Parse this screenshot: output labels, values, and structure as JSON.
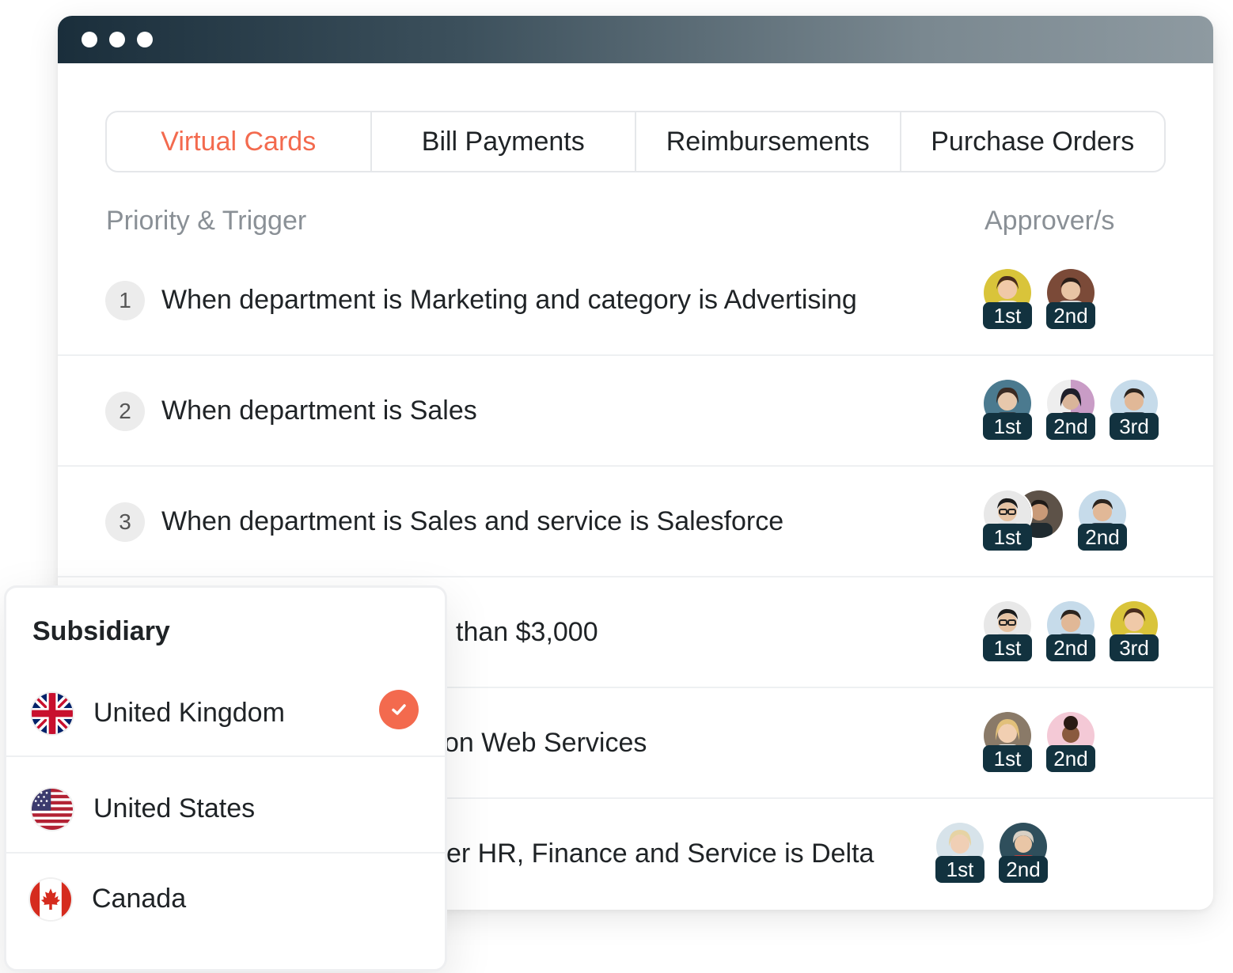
{
  "tabs": [
    "Virtual Cards",
    "Bill Payments",
    "Reimbursements",
    "Purchase Orders"
  ],
  "active_tab": "Virtual Cards",
  "columns": {
    "trigger": "Priority & Trigger",
    "approvers": "Approver/s"
  },
  "rules": [
    {
      "priority": "1",
      "trigger": "When department is Marketing and category is Advertising",
      "approvers": [
        "1st",
        "2nd"
      ]
    },
    {
      "priority": "2",
      "trigger": "When department is Sales",
      "approvers": [
        "1st",
        "2nd",
        "3rd"
      ]
    },
    {
      "priority": "3",
      "trigger": "When department is Sales and service is Salesforce",
      "approvers": [
        "1st",
        "2nd"
      ]
    },
    {
      "trigger": "than $3,000",
      "approvers": [
        "1st",
        "2nd",
        "3rd"
      ]
    },
    {
      "trigger": "on Web Services",
      "approvers": [
        "1st",
        "2nd"
      ]
    },
    {
      "trigger": "er HR, Finance and Service is Delta",
      "approvers": [
        "1st",
        "2nd"
      ]
    }
  ],
  "subsidiary": {
    "title": "Subsidiary",
    "options": [
      {
        "label": "United Kingdom",
        "flag": "uk-flag-icon",
        "selected": true
      },
      {
        "label": "United States",
        "flag": "us-flag-icon",
        "selected": false
      },
      {
        "label": "Canada",
        "flag": "canada-flag-icon",
        "selected": false
      }
    ]
  },
  "colors": {
    "accent": "#f36a4e",
    "badge": "#12323f"
  }
}
